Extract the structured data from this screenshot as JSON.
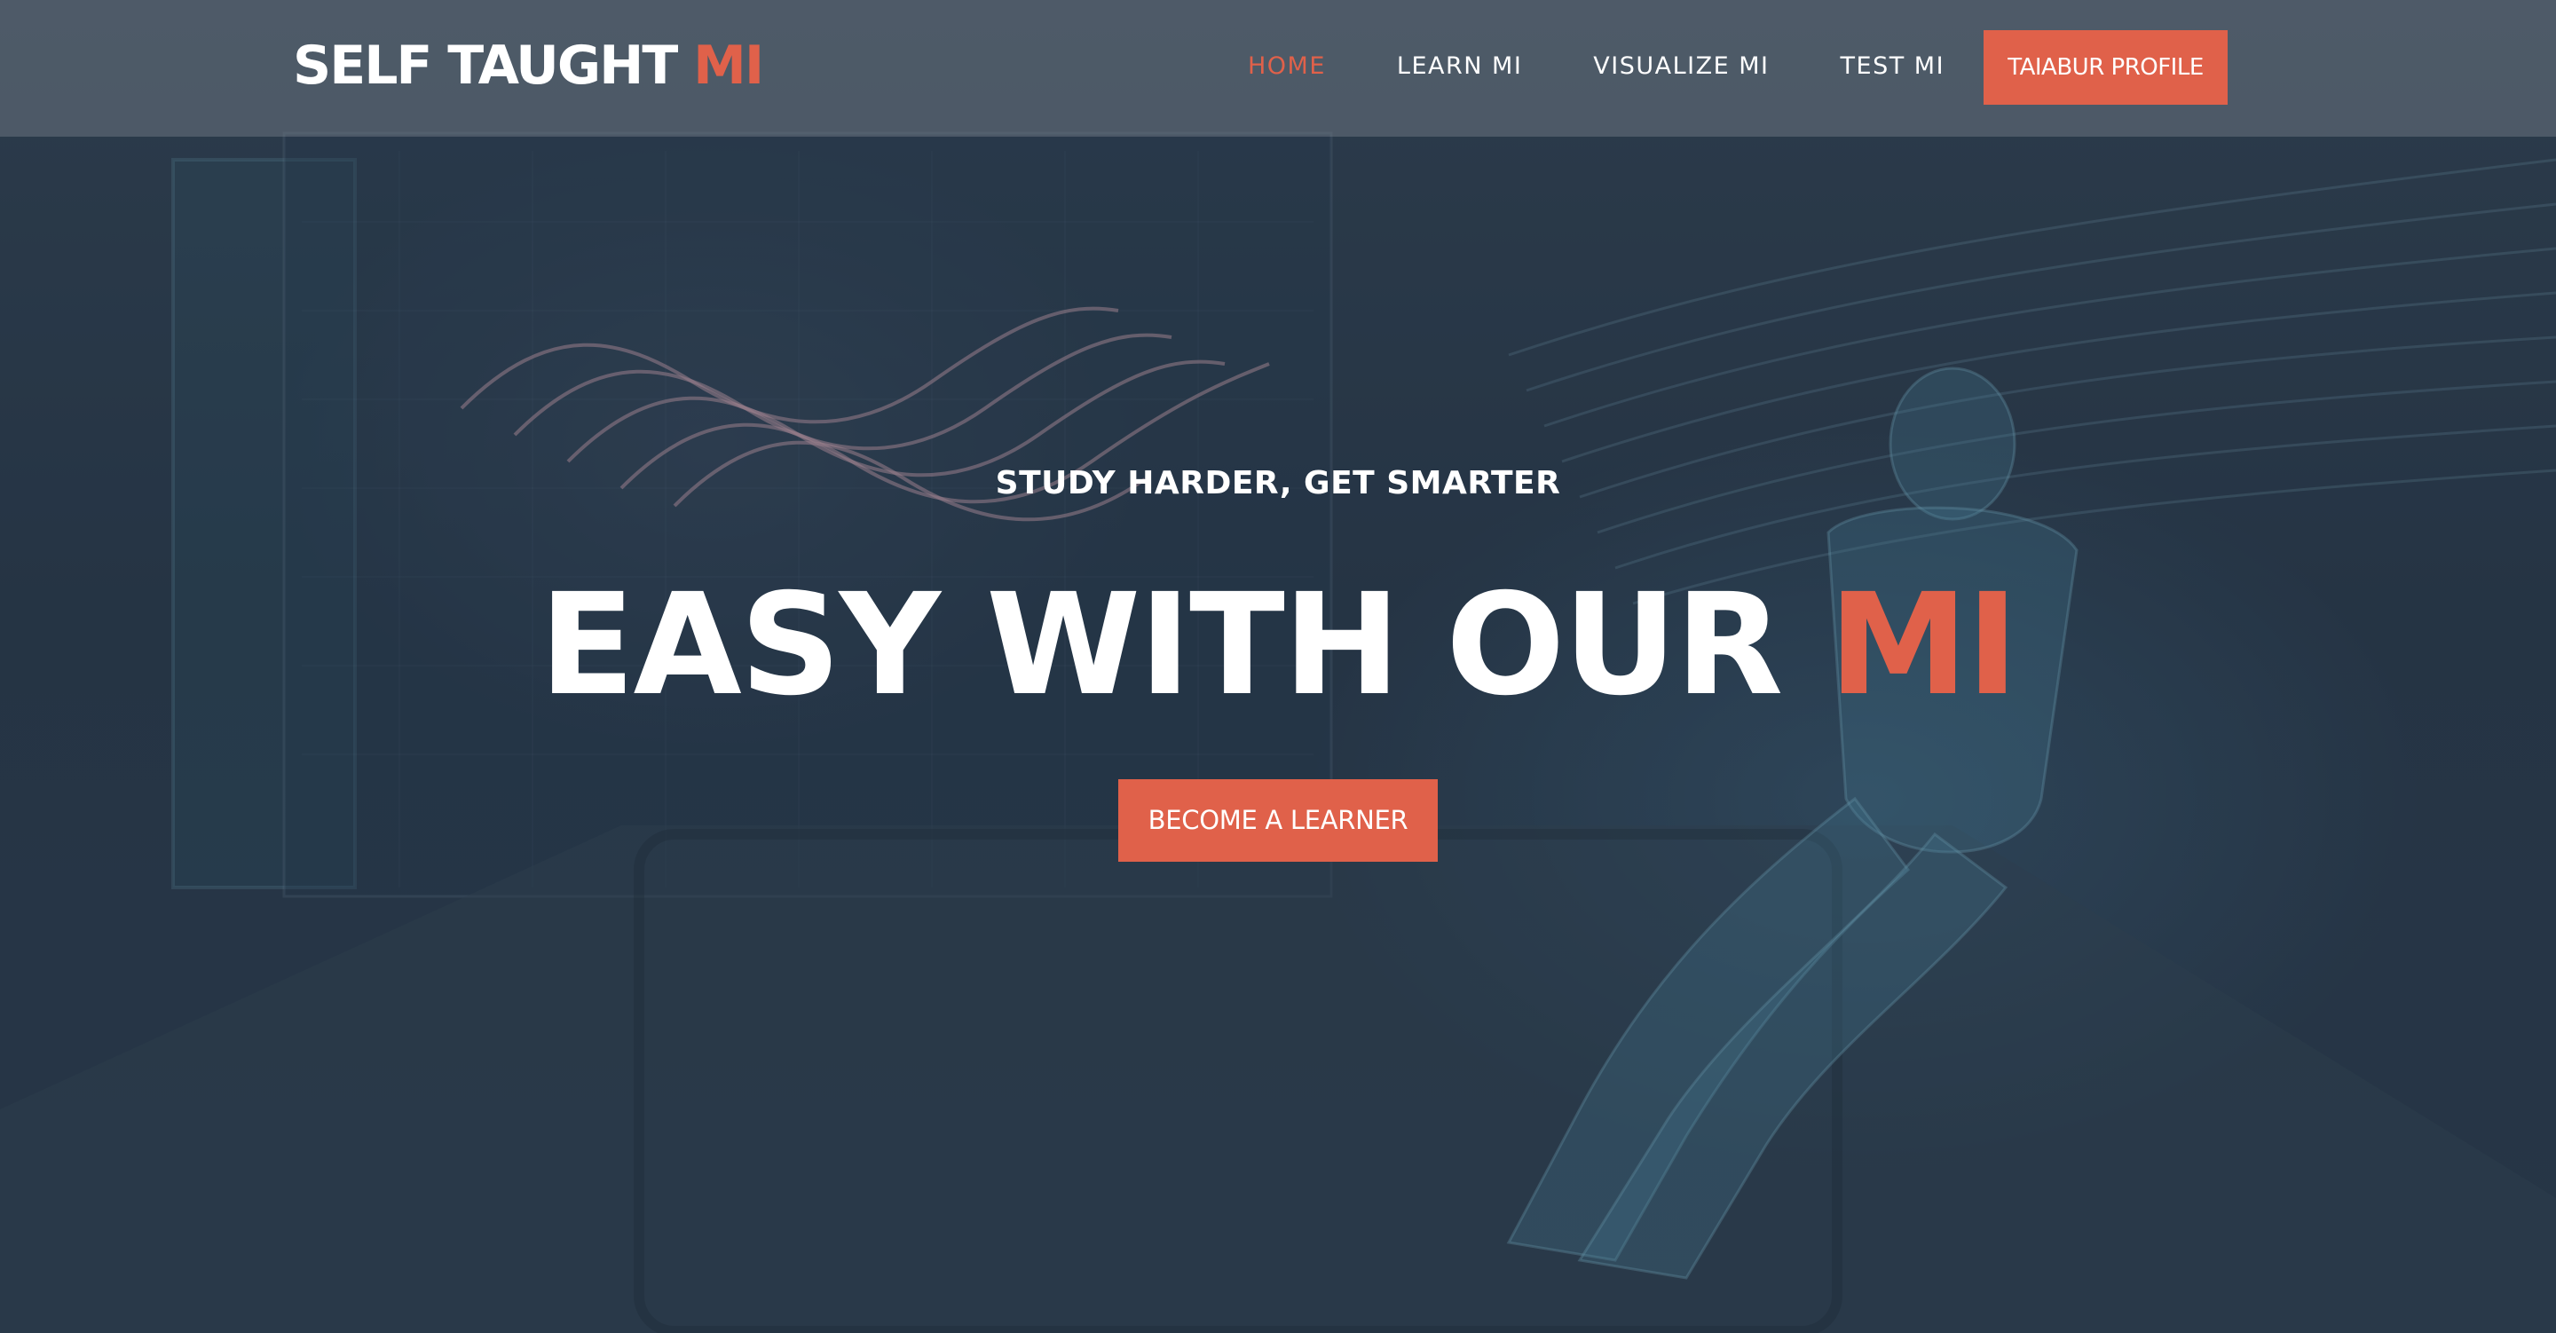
{
  "brand": {
    "name_main": "SELF TAUGHT",
    "name_accent": "MI"
  },
  "nav": {
    "items": [
      {
        "label": "HOME",
        "active": true
      },
      {
        "label": "LEARN MI",
        "active": false
      },
      {
        "label": "VISUALIZE MI",
        "active": false
      },
      {
        "label": "TEST MI",
        "active": false
      }
    ],
    "profile_button": "TAIABUR PROFILE"
  },
  "hero": {
    "eyebrow": "STUDY HARDER, GET SMARTER",
    "headline_main": "EASY WITH OUR",
    "headline_accent": "MI",
    "cta_label": "BECOME A LEARNER"
  },
  "colors": {
    "accent": "#e0614a",
    "text": "#ffffff",
    "header_bg": "rgba(120,128,140,0.45)",
    "hero_bg": "#2c3a4b"
  }
}
